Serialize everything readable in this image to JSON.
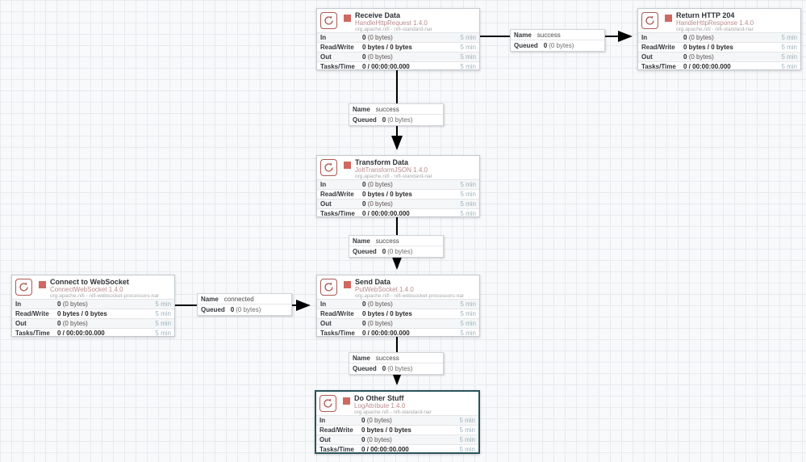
{
  "app": "Apache NiFi flow canvas",
  "stats_labels": {
    "in": "In",
    "read_write": "Read/Write",
    "out": "Out",
    "tasks_time": "Tasks/Time",
    "time_window": "5 min"
  },
  "connection_labels": {
    "name": "Name",
    "queued": "Queued"
  },
  "colors": {
    "processor_accent": "#aa5a54",
    "stopped_square": "#cf6862",
    "type_text": "#bb8b8d",
    "selected_border": "#2a545c",
    "wire": "#000000"
  },
  "icons": {
    "processor_icon": "circular-arrows-icon",
    "run_status_icon": "stopped-square-icon"
  },
  "processors": [
    {
      "name": "Receive Data",
      "type": "HandleHttpRequest 1.4.0",
      "bundle": "org.apache.nifi - nifi-standard-nar",
      "in_count": "0",
      "in_size": "(0 bytes)",
      "read_write": "0 bytes / 0 bytes",
      "out_count": "0",
      "out_size": "(0 bytes)",
      "tasks_time": "0 / 00:00:00.000"
    },
    {
      "name": "Return HTTP 204",
      "type": "HandleHttpResponse 1.4.0",
      "bundle": "org.apache.nifi - nifi-standard-nar",
      "in_count": "0",
      "in_size": "(0 bytes)",
      "read_write": "0 bytes / 0 bytes",
      "out_count": "0",
      "out_size": "(0 bytes)",
      "tasks_time": "0 / 00:00:00.000"
    },
    {
      "name": "Transform Data",
      "type": "JoltTransformJSON 1.4.0",
      "bundle": "org.apache.nifi - nifi-standard-nar",
      "in_count": "0",
      "in_size": "(0 bytes)",
      "read_write": "0 bytes / 0 bytes",
      "out_count": "0",
      "out_size": "(0 bytes)",
      "tasks_time": "0 / 00:00:00.000"
    },
    {
      "name": "Connect to WebSocket",
      "type": "ConnectWebSocket 1.4.0",
      "bundle": "org.apache.nifi - nifi-websocket-processors-nar",
      "in_count": "0",
      "in_size": "(0 bytes)",
      "read_write": "0 bytes / 0 bytes",
      "out_count": "0",
      "out_size": "(0 bytes)",
      "tasks_time": "0 / 00:00:00.000"
    },
    {
      "name": "Send Data",
      "type": "PutWebSocket 1.4.0",
      "bundle": "org.apache.nifi - nifi-websocket-processors-nar",
      "in_count": "0",
      "in_size": "(0 bytes)",
      "read_write": "0 bytes / 0 bytes",
      "out_count": "0",
      "out_size": "(0 bytes)",
      "tasks_time": "0 / 00:00:00.000"
    },
    {
      "name": "Do Other Stuff",
      "type": "LogAttribute 1.4.0",
      "bundle": "org.apache.nifi - nifi-standard-nar",
      "selected": true,
      "in_count": "0",
      "in_size": "(0 bytes)",
      "read_write": "0 bytes / 0 bytes",
      "out_count": "0",
      "out_size": "(0 bytes)",
      "tasks_time": "0 / 00:00:00.000"
    }
  ],
  "connections": [
    {
      "from": "Receive Data",
      "to": "Return HTTP 204",
      "name_value": "success",
      "queued_count": "0",
      "queued_size": "(0 bytes)"
    },
    {
      "from": "Receive Data",
      "to": "Transform Data",
      "name_value": "success",
      "queued_count": "0",
      "queued_size": "(0 bytes)"
    },
    {
      "from": "Transform Data",
      "to": "Send Data",
      "name_value": "success",
      "queued_count": "0",
      "queued_size": "(0 bytes)"
    },
    {
      "from": "Connect to WebSocket",
      "to": "Send Data",
      "name_value": "connected",
      "queued_count": "0",
      "queued_size": "(0 bytes)"
    },
    {
      "from": "Send Data",
      "to": "Do Other Stuff",
      "name_value": "success",
      "queued_count": "0",
      "queued_size": "(0 bytes)"
    }
  ]
}
